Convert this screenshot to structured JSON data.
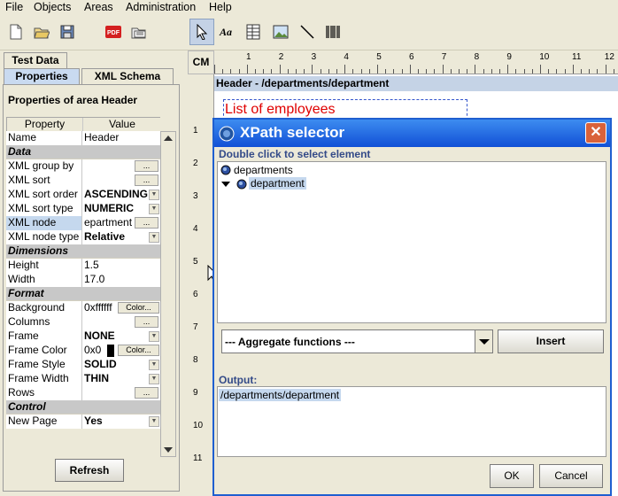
{
  "menu": [
    "File",
    "Objects",
    "Areas",
    "Administration",
    "Help"
  ],
  "toolbar": {
    "icons": [
      "new-document-icon",
      "open-folder-icon",
      "save-disk-icon",
      "pdf-icon",
      "open-report-icon",
      "pointer-icon",
      "text-tool-icon",
      "table-tool-icon",
      "image-tool-icon",
      "line-tool-icon",
      "barcode-tool-icon"
    ],
    "pdf_label": "PDF"
  },
  "left_panel": {
    "tabs": [
      "Test Data",
      "Properties",
      "XML Schema"
    ],
    "title": "Properties of area Header",
    "columns": [
      "Property",
      "Value"
    ],
    "rows": [
      {
        "type": "norm",
        "name": "Name",
        "value": "Header"
      },
      {
        "type": "sec",
        "name": "Data"
      },
      {
        "type": "dots",
        "name": "XML group by",
        "value": ""
      },
      {
        "type": "dots",
        "name": "XML sort",
        "value": ""
      },
      {
        "type": "combo",
        "name": "XML sort order",
        "value": "ASCENDING"
      },
      {
        "type": "combo",
        "name": "XML sort type",
        "value": "NUMERIC"
      },
      {
        "type": "dots",
        "name": "XML node",
        "value": "epartment",
        "selected": true
      },
      {
        "type": "combo",
        "name": "XML node type",
        "value": "Relative"
      },
      {
        "type": "sec",
        "name": "Dimensions"
      },
      {
        "type": "norm",
        "name": "Height",
        "value": "1.5"
      },
      {
        "type": "norm",
        "name": "Width",
        "value": "17.0"
      },
      {
        "type": "sec",
        "name": "Format"
      },
      {
        "type": "color",
        "name": "Background",
        "value": "0xffffff"
      },
      {
        "type": "dots",
        "name": "Columns",
        "value": ""
      },
      {
        "type": "combo",
        "name": "Frame",
        "value": "NONE"
      },
      {
        "type": "color",
        "name": "Frame Color",
        "value": "0x0",
        "swatch": "#000000"
      },
      {
        "type": "combo",
        "name": "Frame Style",
        "value": "SOLID"
      },
      {
        "type": "combo",
        "name": "Frame Width",
        "value": "THIN"
      },
      {
        "type": "dots",
        "name": "Rows",
        "value": ""
      },
      {
        "type": "sec",
        "name": "Control"
      },
      {
        "type": "combo",
        "name": "New Page",
        "value": "Yes"
      }
    ],
    "dots_label": "...",
    "color_label": "Color...",
    "refresh_label": "Refresh"
  },
  "canvas": {
    "ruler_unit": "CM",
    "h_ticks": [
      "1",
      "2",
      "3",
      "4",
      "5",
      "6",
      "7",
      "8",
      "9",
      "10",
      "11",
      "12"
    ],
    "v_ticks": [
      "1",
      "2",
      "3",
      "4",
      "5",
      "6",
      "7",
      "8",
      "9",
      "10",
      "11"
    ],
    "band_header": "Header - /departments/department",
    "title_text": "List of employees"
  },
  "dialog": {
    "title": "XPath selector",
    "instruction": "Double click to select element",
    "tree": {
      "root": "departments",
      "child": "department"
    },
    "aggregate_placeholder": "--- Aggregate functions ---",
    "insert_label": "Insert",
    "output_label": "Output:",
    "output_value": "/departments/department",
    "ok_label": "OK",
    "cancel_label": "Cancel"
  }
}
